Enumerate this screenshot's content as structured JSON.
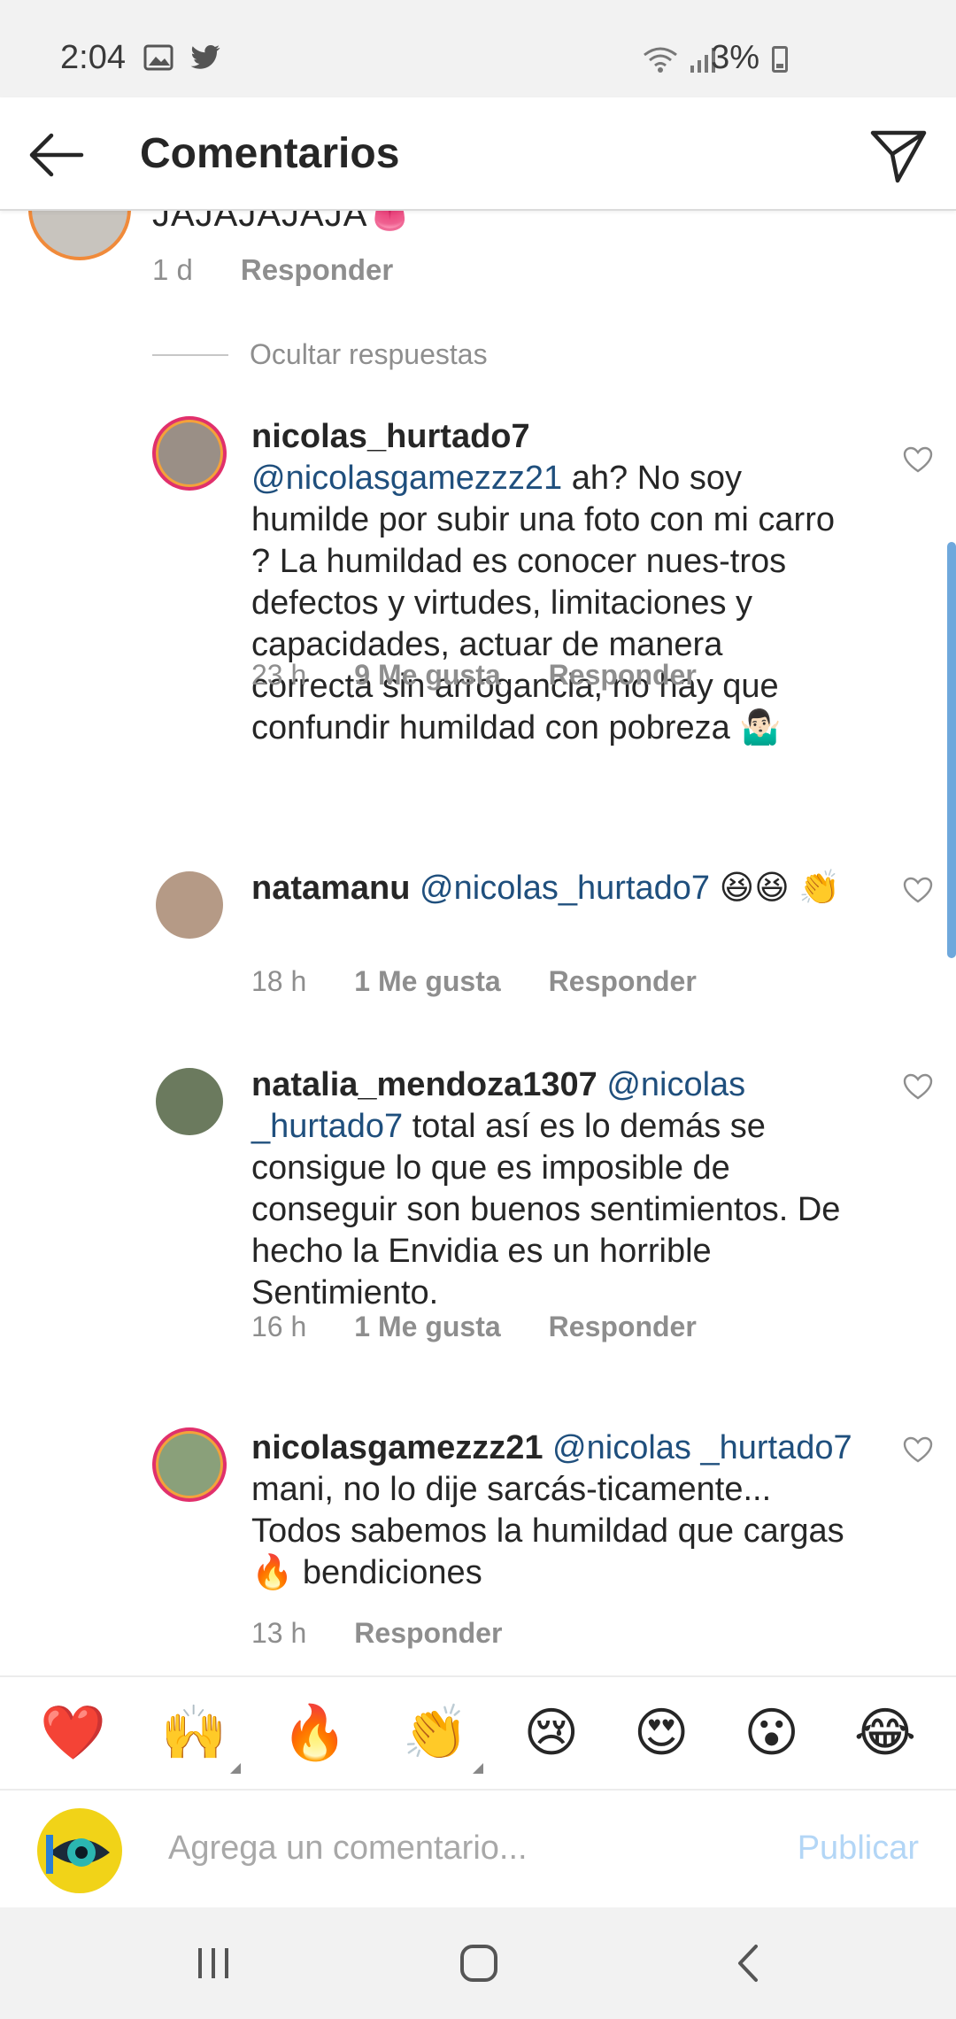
{
  "status_bar": {
    "time": "2:04",
    "battery": "3%",
    "left_icons": [
      "image-icon",
      "twitter-icon"
    ],
    "right_icons": [
      "wifi-icon",
      "signal-icon",
      "battery-icon"
    ]
  },
  "header": {
    "title": "Comentarios",
    "back_icon": "arrow-left-icon",
    "send_icon": "paper-plane-icon"
  },
  "parent_comment": {
    "text": "JAJAJAJAJA",
    "emoji": "👅",
    "age": "1 d",
    "reply_label": "Responder"
  },
  "hide_replies_label": "Ocultar respuestas",
  "replies": [
    {
      "user": "nicolas_hurtado7",
      "mention": "@nicolasgamezzz21",
      "text": " ah? No soy humilde por subir una foto con mi carro ? La humildad es conocer nues-tros defectos y virtudes, limitaciones y capacidades, actuar de manera correcta sin  arrogancia, no hay que confundir humildad con pobreza 🤷🏻‍♂️",
      "age": "23 h",
      "likes": "9 Me gusta",
      "reply_label": "Responder"
    },
    {
      "user": "natamanu",
      "mention": "@nicolas_hurtado7",
      "text": " 😆😆 👏",
      "age": "18 h",
      "likes": "1 Me gusta",
      "reply_label": "Responder"
    },
    {
      "user": "natalia_mendoza1307",
      "mention": "@nicolas _hurtado7",
      "text": " total así es lo demás se consigue lo que es imposible de conseguir son buenos sentimientos. De hecho la Envidia es un horrible Sentimiento.",
      "age": "16 h",
      "likes": "1 Me gusta",
      "reply_label": "Responder"
    },
    {
      "user": "nicolasgamezzz21",
      "mention": "@nicolas _hurtado7",
      "text": "  mani, no lo dije sarcás-ticamente... Todos sabemos la humildad que cargas🔥 bendiciones",
      "age": "13 h",
      "likes": "",
      "reply_label": "Responder"
    }
  ],
  "emoji_bar": [
    "❤️",
    "🙌",
    "🔥",
    "👏",
    "😢",
    "😍",
    "😮",
    "😂"
  ],
  "composer": {
    "placeholder": "Agrega un comentario...",
    "post_label": "Publicar"
  },
  "nav": [
    "recents-icon",
    "home-icon",
    "back-nav-icon"
  ],
  "colors": {
    "mention": "#1f4f7d",
    "meta": "#8e8e8e",
    "post_disabled": "#b3d6f6"
  }
}
